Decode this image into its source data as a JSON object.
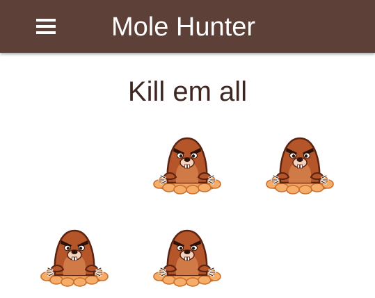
{
  "app_bar": {
    "title": "Mole Hunter",
    "menu_icon": "hamburger-menu-icon",
    "background": "#5d4037",
    "title_color": "#ffffff"
  },
  "game": {
    "instruction": "Kill em all",
    "mole_icon": "angry-mole-icon",
    "grid_columns": 3,
    "grid_rows": 2,
    "holes": [
      {
        "row": 1,
        "col": 1,
        "mole": false
      },
      {
        "row": 1,
        "col": 2,
        "mole": true
      },
      {
        "row": 1,
        "col": 3,
        "mole": true
      },
      {
        "row": 2,
        "col": 1,
        "mole": true
      },
      {
        "row": 2,
        "col": 2,
        "mole": true
      },
      {
        "row": 2,
        "col": 3,
        "mole": false
      }
    ]
  }
}
